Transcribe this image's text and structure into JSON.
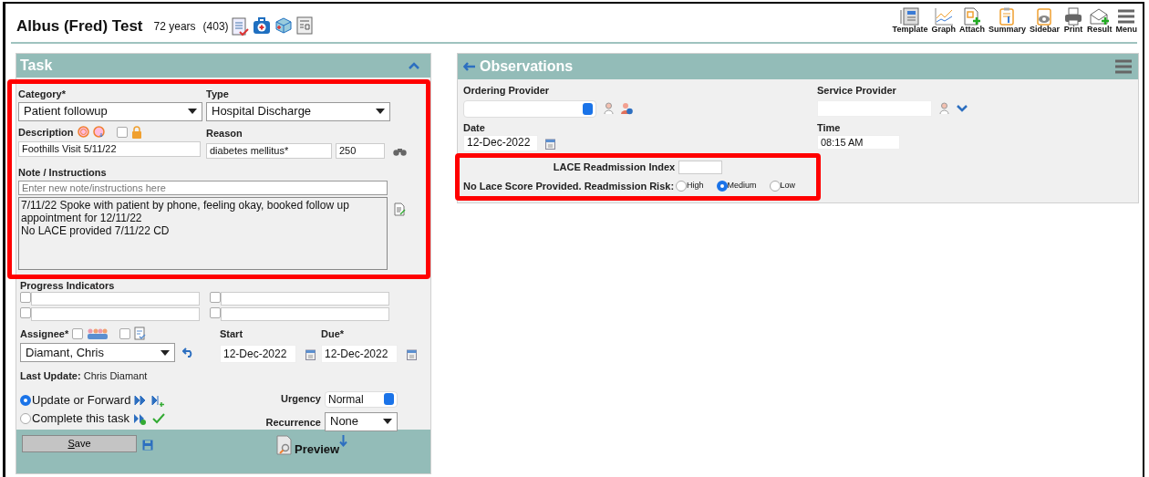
{
  "patient": {
    "name": "Albus (Fred) Test",
    "age": "72 years",
    "count": "(403)"
  },
  "toolbar": [
    {
      "kind": "template",
      "label": "Template"
    },
    {
      "kind": "graph",
      "label": "Graph"
    },
    {
      "kind": "attach",
      "label": "Attach"
    },
    {
      "kind": "summary",
      "label": "Summary"
    },
    {
      "kind": "sidebar",
      "label": "Sidebar"
    },
    {
      "kind": "print",
      "label": "Print"
    },
    {
      "kind": "result",
      "label": "Result"
    },
    {
      "kind": "menu",
      "label": "Menu"
    }
  ],
  "task": {
    "title": "Task",
    "category": {
      "label": "Category*",
      "value": "Patient followup"
    },
    "type": {
      "label": "Type",
      "value": "Hospital Discharge"
    },
    "description": {
      "label": "Description",
      "value": "Foothills Visit 5/11/22",
      "locked": false
    },
    "reason": {
      "label": "Reason",
      "value": "diabetes mellitus*",
      "code": "250"
    },
    "note": {
      "label": "Note / Instructions",
      "placeholder": "Enter new note/instructions here",
      "history": [
        "7/11/22 Spoke with patient by phone, feeling okay, booked follow up appointment for 12/11/22",
        "No LACE provided 7/11/22 CD"
      ]
    },
    "progress": {
      "label": "Progress Indicators",
      "items": [
        {
          "checked": false
        },
        {
          "checked": false
        },
        {
          "checked": false
        },
        {
          "checked": false
        }
      ]
    },
    "assignee": {
      "label": "Assignee*",
      "value": "Diamant, Chris",
      "group_checked": false,
      "template_checked": false
    },
    "start": {
      "label": "Start",
      "value": "12-Dec-2022"
    },
    "due": {
      "label": "Due*",
      "value": "12-Dec-2022"
    },
    "last_update": {
      "label": "Last Update:",
      "value": "Chris Diamant"
    },
    "actions": [
      {
        "label": "Update or Forward",
        "selected": true
      },
      {
        "label": "Complete this task",
        "selected": false
      }
    ],
    "urgency": {
      "label": "Urgency",
      "value": "Normal"
    },
    "recurrence": {
      "label": "Recurrence",
      "value": "None"
    },
    "save": "Save",
    "preview": "Preview"
  },
  "observations": {
    "title": "Observations",
    "ordering_provider": {
      "label": "Ordering Provider"
    },
    "service_provider": {
      "label": "Service Provider"
    },
    "date": {
      "label": "Date",
      "value": "12-Dec-2022"
    },
    "time": {
      "label": "Time",
      "value": "08:15 AM"
    },
    "lace": {
      "label": "LACE Readmission Index"
    },
    "risk": {
      "label": "No Lace Score Provided. Readmission Risk:",
      "options": [
        {
          "label": "High",
          "selected": false
        },
        {
          "label": "Medium",
          "selected": true
        },
        {
          "label": "Low",
          "selected": false
        }
      ]
    }
  }
}
